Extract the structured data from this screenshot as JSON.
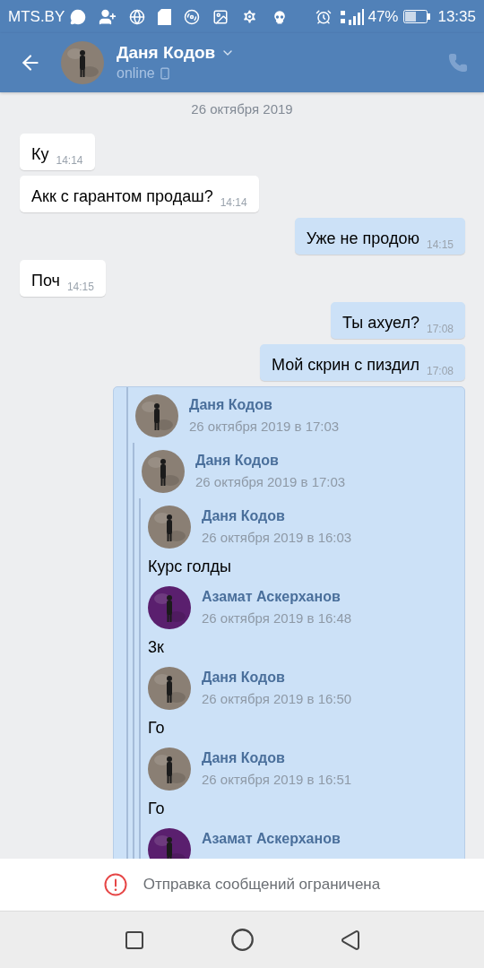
{
  "status_bar": {
    "carrier": "MTS.BY",
    "battery": "47%",
    "time": "13:35"
  },
  "header": {
    "name": "Даня Кодов",
    "status": "online"
  },
  "date": "26 октября 2019",
  "messages": [
    {
      "kind": "text",
      "outgoing": false,
      "text": "Ку",
      "time": "14:14"
    },
    {
      "kind": "text",
      "outgoing": false,
      "text": "Акк с гарантом продаш?",
      "time": "14:14"
    },
    {
      "kind": "text",
      "outgoing": true,
      "text": "Уже не продою",
      "time": "14:15"
    },
    {
      "kind": "text",
      "outgoing": false,
      "text": "Поч",
      "time": "14:15"
    },
    {
      "kind": "text",
      "outgoing": true,
      "text": "Ты ахуел?",
      "time": "17:08"
    },
    {
      "kind": "text",
      "outgoing": true,
      "text": "Мой скрин с пиздил",
      "time": "17:08"
    },
    {
      "kind": "forward",
      "outgoing": true,
      "forwarded": [
        {
          "author": "Даня Кодов",
          "color": "#8a7f74",
          "time": "26 октября 2019 в 17:03",
          "forwarded": [
            {
              "author": "Даня Кодов",
              "color": "#8a7f74",
              "time": "26 октября 2019 в 17:03",
              "forwarded": [
                {
                  "author": "Даня Кодов",
                  "color": "#8a7f74",
                  "time": "26 октября 2019 в 16:03",
                  "text": "Курс голды"
                },
                {
                  "author": "Азамат Аскерханов",
                  "color": "#5a1f6e",
                  "time": "26 октября 2019 в 16:48",
                  "text": "3к"
                },
                {
                  "author": "Даня Кодов",
                  "color": "#8a7f74",
                  "time": "26 октября 2019 в 16:50",
                  "text": "Го"
                },
                {
                  "author": "Даня Кодов",
                  "color": "#8a7f74",
                  "time": "26 октября 2019 в 16:51",
                  "text": "Го"
                },
                {
                  "author": "Азамат Аскерханов",
                  "color": "#5a1f6e"
                }
              ]
            }
          ]
        }
      ]
    }
  ],
  "notice": "Отправка сообщений ограничена"
}
